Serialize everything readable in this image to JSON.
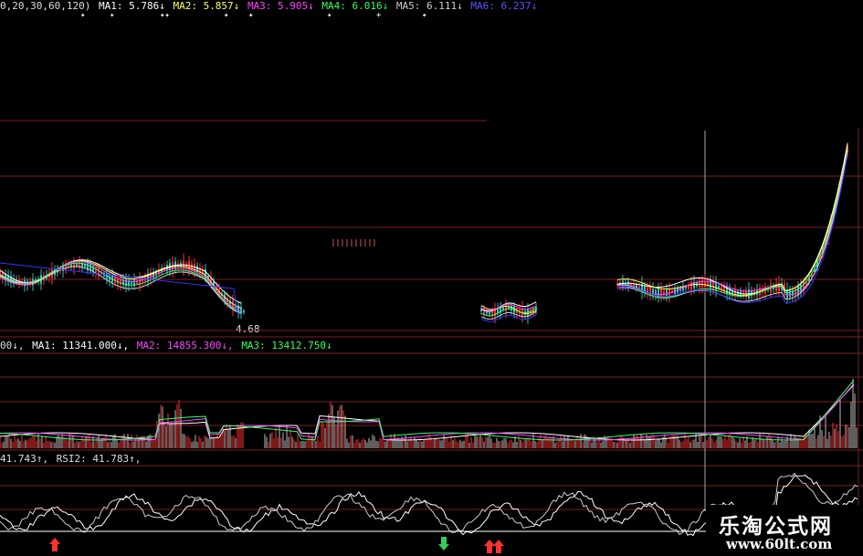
{
  "price_panel": {
    "header": {
      "params": "0,20,30,60,120)",
      "ma1": "MA1: 5.786↓",
      "ma2": "MA2: 5.857↓",
      "ma3": "MA3: 5.905↓",
      "ma4": "MA4: 6.016↓",
      "ma5": "MA5: 6.111↓",
      "ma6": "MA6: 6.237↓"
    },
    "low_label": "4.68"
  },
  "volume_panel": {
    "header": {
      "prefix": "00↓,",
      "ma1": "MA1: 11341.000↓,",
      "ma2": "MA2: 14855.300↓,",
      "ma3": "MA3: 13412.750↓"
    }
  },
  "rsi_panel": {
    "header": {
      "rsi1": "41.743↑,",
      "rsi2": "RSI2: 41.783↑,"
    }
  },
  "watermark": {
    "title": "乐淘公式网",
    "url": "www.60lt.com"
  },
  "colors": {
    "ma1": "#ffffff",
    "ma2": "#ffff55",
    "ma3": "#ff44ff",
    "ma4": "#33ff66",
    "ma5": "#cccccc",
    "ma6": "#3333ff",
    "grid": "#7a1f1f",
    "up": "#ff3030",
    "down": "#30c0c0"
  }
}
